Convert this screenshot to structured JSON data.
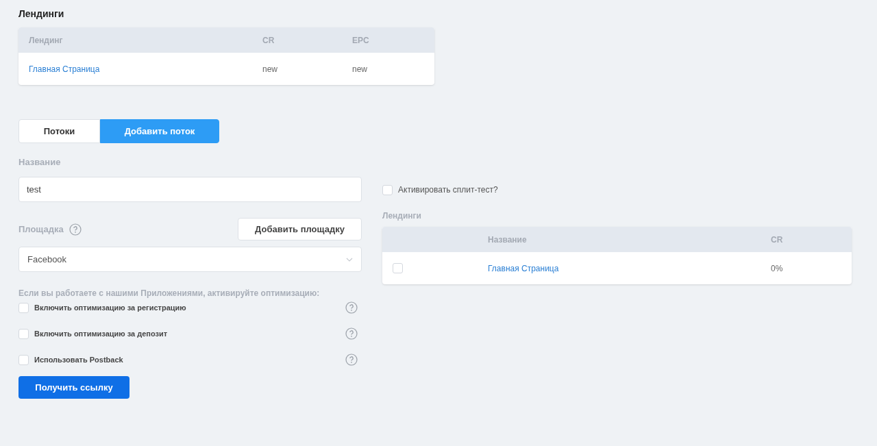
{
  "landings_section": {
    "title": "Лендинги",
    "columns": [
      "Лендинг",
      "CR",
      "EPC"
    ],
    "rows": [
      {
        "name": "Главная Страница",
        "cr": "new",
        "epc": "new"
      }
    ]
  },
  "tabs": [
    {
      "label": "Потоки",
      "selected": false
    },
    {
      "label": "Добавить поток",
      "selected": true
    }
  ],
  "form": {
    "name_label": "Название",
    "name_value": "test",
    "platform_label": "Площадка",
    "add_platform_button": "Добавить площадку",
    "platform_value": "Facebook",
    "optimization_hint": "Если вы работаете с нашими Приложениями, активируйте оптимизацию:",
    "options": [
      {
        "label": "Включить оптимизацию за регистрацию",
        "checked": false
      },
      {
        "label": "Включить оптимизацию за депозит",
        "checked": false
      },
      {
        "label": "Использовать Postback",
        "checked": false
      }
    ],
    "submit_button": "Получить ссылку"
  },
  "split": {
    "label": "Активировать сплит-тест?",
    "checked": false,
    "landings_label": "Лендинги",
    "columns": [
      "Название",
      "CR"
    ],
    "rows": [
      {
        "name": "Главная Страница",
        "cr": "0%",
        "checked": false
      }
    ]
  }
}
